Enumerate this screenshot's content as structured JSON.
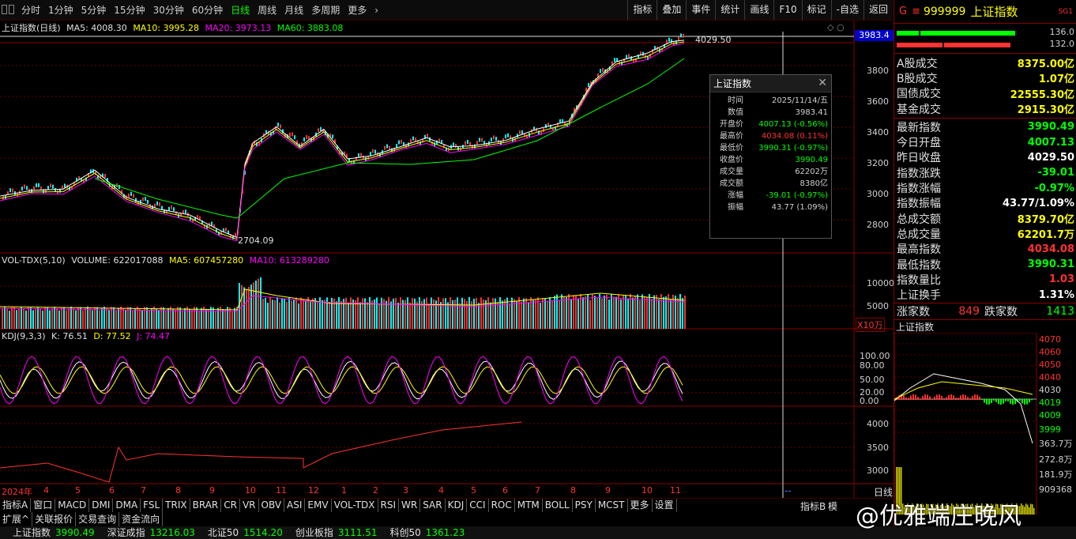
{
  "colors": {
    "up": "#ff3232",
    "down": "#00ffff",
    "green": "#00ff00",
    "yellow": "#ffff00",
    "magenta": "#ff00ff",
    "white": "#ffffff",
    "panel_border": "#8a0000"
  },
  "toolbar": {
    "periods": [
      "分时",
      "1分钟",
      "5分钟",
      "15分钟",
      "30分钟",
      "60分钟",
      "日线",
      "周线",
      "月线",
      "多周期",
      "更多"
    ],
    "active_period": "日线",
    "tools": [
      "指标",
      "叠加",
      "事件",
      "统计",
      "画线",
      "F10",
      "标记",
      "-自选",
      "返回"
    ]
  },
  "price_legend": {
    "name": "上证指数(日线)",
    "ma5": "MA5: 4008.30",
    "ma10": "MA10: 3995.28",
    "ma20": "MA20: 3973.13",
    "ma60": "MA60: 3883.08"
  },
  "price_axis": {
    "ticks": [
      "3800",
      "3600",
      "3400",
      "3200",
      "3000",
      "2800"
    ],
    "cursor_value": "3983.4"
  },
  "price_marks": {
    "high": "4029.50",
    "low": "2704.09"
  },
  "vol_legend": {
    "name": "VOL-TDX(5,10)",
    "volume": "VOLUME: 622017088",
    "ma5": "MA5: 607457280",
    "ma10": "MA10: 613289280"
  },
  "vol_axis": {
    "ticks": [
      "10000",
      "5000"
    ],
    "unit": "X10万"
  },
  "kdj_legend": {
    "name": "KDJ(9,3,3)",
    "k": "K: 76.51",
    "d": "D: 77.52",
    "j": "J: 74.47"
  },
  "kdj_axis": {
    "ticks": [
      "100.00",
      "80.00",
      "50.00",
      "20.00",
      "0.00"
    ]
  },
  "sub3_axis": {
    "ticks": [
      "4000",
      "3500",
      "3000"
    ]
  },
  "date_axis": [
    "2024年",
    "4",
    "5",
    "6",
    "7",
    "8",
    "9",
    "10",
    "11",
    "12",
    "1",
    "2",
    "3",
    "4",
    "5",
    "6",
    "7",
    "8",
    "9",
    "10",
    "11"
  ],
  "popup": {
    "title": "上证指数",
    "rows": [
      {
        "k": "时间",
        "v": "2025/11/14/五",
        "c": "#d0d0d0"
      },
      {
        "k": "数值",
        "v": "3983.41",
        "c": "#d0d0d0"
      },
      {
        "k": "开盘价",
        "v": "4007.13 (-0.56%)",
        "c": "#00ff00"
      },
      {
        "k": "最高价",
        "v": "4034.08 (0.11%)",
        "c": "#ff3232"
      },
      {
        "k": "最低价",
        "v": "3990.31 (-0.97%)",
        "c": "#00ff00"
      },
      {
        "k": "收盘价",
        "v": "3990.49",
        "c": "#00ff00"
      },
      {
        "k": "成交量",
        "v": "62202万",
        "c": "#d0d0d0"
      },
      {
        "k": "成交额",
        "v": "8380亿",
        "c": "#d0d0d0"
      },
      {
        "k": "涨幅",
        "v": "-39.01 (-0.97%)",
        "c": "#00ff00"
      },
      {
        "k": "振幅",
        "v": "43.77 (1.09%)",
        "c": "#d0d0d0"
      }
    ]
  },
  "right_panel": {
    "code": "999999",
    "name": "上证指数",
    "g": "G",
    "tag": "SG1",
    "bar_top": "136.0",
    "bar_bottom": "132.0",
    "rows1": [
      {
        "k": "A股成交",
        "v": "8375.00亿",
        "c": "#ffff00"
      },
      {
        "k": "B股成交",
        "v": "1.07亿",
        "c": "#ffff00"
      },
      {
        "k": "国债成交",
        "v": "22555.30亿",
        "c": "#ffff00"
      },
      {
        "k": "基金成交",
        "v": "2915.30亿",
        "c": "#ffff00"
      }
    ],
    "rows2": [
      {
        "k": "最新指数",
        "v": "3990.49",
        "c": "#00ff00"
      },
      {
        "k": "今日开盘",
        "v": "4007.13",
        "c": "#00ff00"
      },
      {
        "k": "昨日收盘",
        "v": "4029.50",
        "c": "#ffffff"
      },
      {
        "k": "指数涨跌",
        "v": "-39.01",
        "c": "#00ff00"
      },
      {
        "k": "指数涨幅",
        "v": "-0.97%",
        "c": "#00ff00"
      },
      {
        "k": "指数振幅",
        "v": "43.77/1.09%",
        "c": "#ffffff"
      },
      {
        "k": "总成交额",
        "v": "8379.70亿",
        "c": "#ffff00"
      },
      {
        "k": "总成交量",
        "v": "62201.7万",
        "c": "#ffff00"
      },
      {
        "k": "最高指数",
        "v": "4034.08",
        "c": "#ff3232"
      },
      {
        "k": "最低指数",
        "v": "3990.31",
        "c": "#00ff00"
      },
      {
        "k": "指数量比",
        "v": "1.03",
        "c": "#ff3232"
      },
      {
        "k": "上证换手",
        "v": "1.31%",
        "c": "#ffffff"
      }
    ],
    "up_label": "涨家数",
    "up_count": "849",
    "down_label": "跌家数",
    "down_count": "1413",
    "mini_title": "上证指数",
    "mini_ticks": [
      "4070",
      "4060",
      "4050",
      "4040",
      "4030",
      "4019",
      "4009",
      "3999",
      "363.7万",
      "272.8万",
      "181.9万",
      "909368"
    ]
  },
  "bottom_tabs": [
    "指标A",
    "窗口",
    "MACD",
    "DMI",
    "DMA",
    "FSL",
    "TRIX",
    "BRAR",
    "CR",
    "VR",
    "OBV",
    "ASI",
    "EMV",
    "VOL-TDX",
    "RSI",
    "WR",
    "SAR",
    "KDJ",
    "CCI",
    "ROC",
    "MTM",
    "BOLL",
    "PSY",
    "MCST",
    "更多",
    "设置"
  ],
  "bottom_tabs2": [
    "扩展^",
    "关联报价",
    "交易查询",
    "资金流向"
  ],
  "right_tabs": [
    "日线",
    "--",
    "指标B",
    "模"
  ],
  "status": [
    {
      "n": "上证指数",
      "v": "3990.49",
      "c": "#00ff00"
    },
    {
      "n": "深证成指",
      "v": "13216.03",
      "c": "#00ff00"
    },
    {
      "n": "北证50",
      "v": "1514.20",
      "c": "#00ff00"
    },
    {
      "n": "创业板指",
      "v": "3111.51",
      "c": "#00ff00"
    },
    {
      "n": "科创50",
      "v": "1361.23",
      "c": "#00ff00"
    }
  ],
  "watermark": "@优雅端庄晚风"
}
